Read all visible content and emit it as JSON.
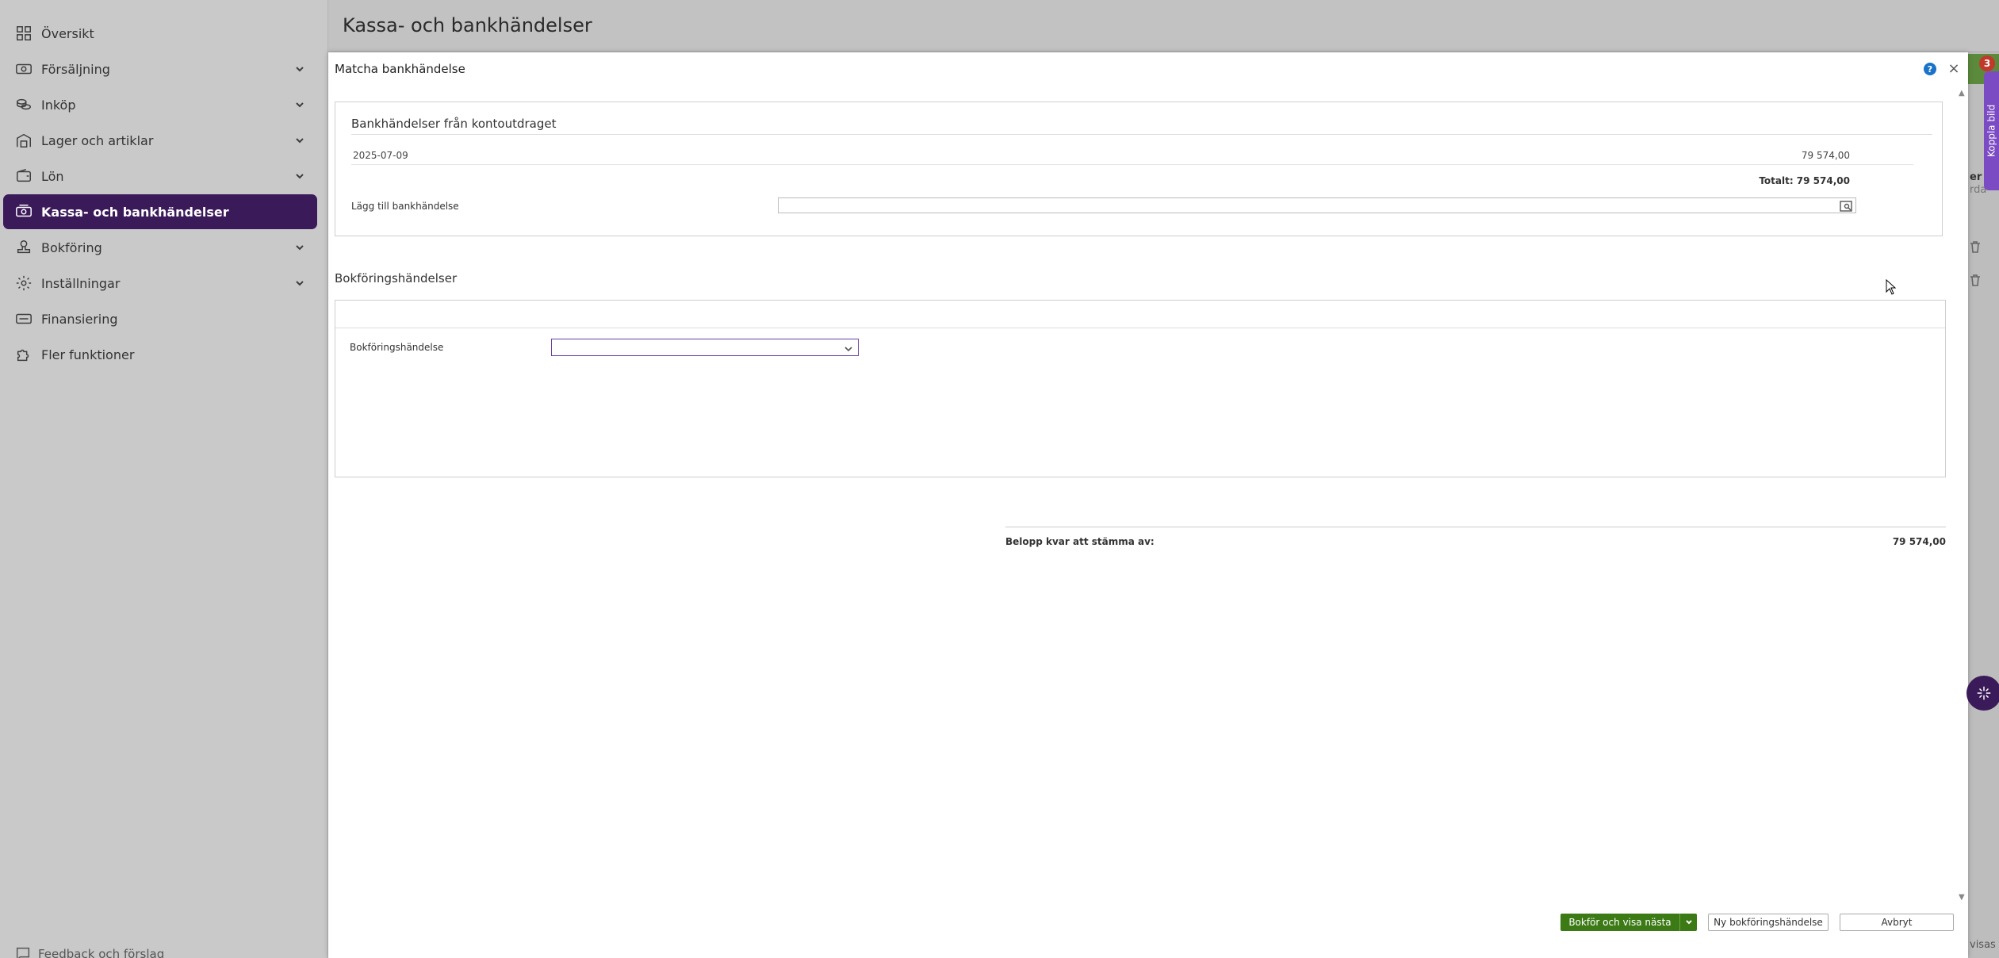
{
  "sidebar": {
    "items": [
      {
        "label": "Översikt",
        "icon": "grid-icon"
      },
      {
        "label": "Försäljning",
        "icon": "money-icon"
      },
      {
        "label": "Inköp",
        "icon": "coins-icon"
      },
      {
        "label": "Lager och artiklar",
        "icon": "warehouse-icon"
      },
      {
        "label": "Lön",
        "icon": "wallet-icon"
      },
      {
        "label": "Kassa- och bankhändelser",
        "icon": "bank-icon"
      },
      {
        "label": "Bokföring",
        "icon": "stamp-icon"
      },
      {
        "label": "Inställningar",
        "icon": "gear-icon"
      },
      {
        "label": "Finansiering",
        "icon": "finance-icon"
      },
      {
        "label": "Fler funktioner",
        "icon": "puzzle-icon"
      }
    ],
    "feedback_label": "Feedback och förslag",
    "active_color": "#3b1a5a"
  },
  "page": {
    "title": "Kassa- och bankhändelser"
  },
  "background": {
    "badge_count": "3",
    "feedback_tab": "Koppla bild",
    "text_er": "er",
    "text_rda": "rda",
    "text_visas": "visas"
  },
  "modal": {
    "title": "Matcha bankhändelse",
    "help_icon": "?",
    "close_icon": "×",
    "bank_section": {
      "heading": "Bankhändelser från kontoutdraget",
      "rows": [
        {
          "date": "2025-07-09",
          "amount": "79 574,00"
        }
      ],
      "total": "Totalt: 79 574,00",
      "add_label": "Lägg till bankhändelse",
      "add_value": ""
    },
    "booking_section": {
      "title": "Bokföringshändelser",
      "field_label": "Bokföringshändelse",
      "select_value": ""
    },
    "balance": {
      "label": "Belopp kvar att stämma av:",
      "value": "79 574,00"
    },
    "buttons": {
      "primary": "Bokför och visa nästa",
      "new": "Ny bokföringshändelse",
      "cancel": "Avbryt"
    },
    "primary_color": "#3c7a16"
  }
}
